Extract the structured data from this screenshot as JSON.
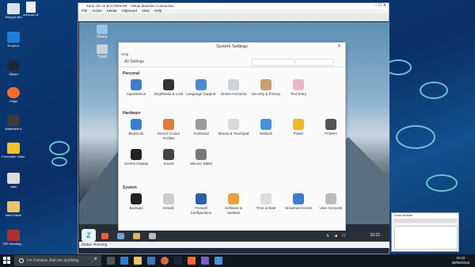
{
  "host_desktop": {
    "icons": [
      {
        "label": "Recycle Bin",
        "icon": "recycle-bin-icon"
      },
      {
        "label": "Dropbox",
        "icon": "dropbox-icon"
      },
      {
        "label": "Steam",
        "icon": "steam-icon"
      },
      {
        "label": "Origin",
        "icon": "origin-icon"
      },
      {
        "label": "Battlefield 4",
        "icon": "battlefield-icon"
      },
      {
        "label": "Freemake Video C...",
        "icon": "freemake-icon"
      },
      {
        "label": "Jake",
        "icon": "folder-icon"
      },
      {
        "label": "New Folder",
        "icon": "folder-icon"
      },
      {
        "label": "MS Mousing...",
        "icon": "mouse-icon"
      }
    ],
    "second_column_icon": {
      "label": "zorin-os-11",
      "icon": "file-icon"
    }
  },
  "vm_window": {
    "title": "Zorin OS on BI-CORSAIR - Virtual Machine Connection",
    "menu": [
      "File",
      "Action",
      "Media",
      "Clipboard",
      "View",
      "Help"
    ],
    "status": "Status: Running"
  },
  "guest_desktop": {
    "icons": [
      {
        "label": "Home"
      },
      {
        "label": "Trash"
      }
    ],
    "panel_time": "15:22"
  },
  "settings": {
    "title": "System Settings",
    "help_menu": "Help",
    "all_settings": "All Settings",
    "sections": {
      "personal": "Personal",
      "hardware": "Hardware",
      "system": "System"
    },
    "personal_items": [
      {
        "label": "Appearance",
        "icon": "appearance-icon",
        "color": "#3d7fc4"
      },
      {
        "label": "Brightness & Lock",
        "icon": "brightness-lock-icon",
        "color": "#333333"
      },
      {
        "label": "Language Support",
        "icon": "language-icon",
        "color": "#4b8ad1"
      },
      {
        "label": "Online Accounts",
        "icon": "cloud-icon",
        "color": "#cfd4da"
      },
      {
        "label": "Security & Privacy",
        "icon": "security-icon",
        "color": "#c9a070"
      },
      {
        "label": "Text Entry",
        "icon": "text-entry-icon",
        "color": "#e8b8c8"
      }
    ],
    "hardware_items": [
      {
        "label": "Bluetooth",
        "icon": "bluetooth-icon",
        "color": "#3b7fd0"
      },
      {
        "label": "Device Colour Profiles",
        "icon": "color-profiles-icon",
        "color": "#e07a3c"
      },
      {
        "label": "Keyboard",
        "icon": "keyboard-icon",
        "color": "#999999"
      },
      {
        "label": "Mouse & Touchpad",
        "icon": "mouse-icon",
        "color": "#d8d8d8"
      },
      {
        "label": "Network",
        "icon": "network-icon",
        "color": "#4a90d9"
      },
      {
        "label": "Power",
        "icon": "power-icon",
        "color": "#f0b820"
      },
      {
        "label": "Printers",
        "icon": "printer-icon",
        "color": "#555555"
      },
      {
        "label": "Screen Display",
        "icon": "display-icon",
        "color": "#222222"
      },
      {
        "label": "Sound",
        "icon": "sound-icon",
        "color": "#444444"
      },
      {
        "label": "Wacom Tablet",
        "icon": "wacom-icon",
        "color": "#777777"
      }
    ],
    "system_items": [
      {
        "label": "Backups",
        "icon": "backups-icon",
        "color": "#222222"
      },
      {
        "label": "Details",
        "icon": "details-icon",
        "color": "#cccccc"
      },
      {
        "label": "Firewall Configuration",
        "icon": "firewall-icon",
        "color": "#2d5fa8"
      },
      {
        "label": "Software & Updates",
        "icon": "software-icon",
        "color": "#e8a040"
      },
      {
        "label": "Time & Date",
        "icon": "clock-icon",
        "color": "#dddddd"
      },
      {
        "label": "Universal Access",
        "icon": "universal-access-icon",
        "color": "#3b7fd0"
      },
      {
        "label": "User Accounts",
        "icon": "user-accounts-icon",
        "color": "#bbbbbb"
      }
    ]
  },
  "mini_window": {
    "title": "Zorin Monitor"
  },
  "taskbar": {
    "search_placeholder": "I'm Cortana. Ask me anything.",
    "time": "15:22",
    "date": "26/05/2016"
  }
}
